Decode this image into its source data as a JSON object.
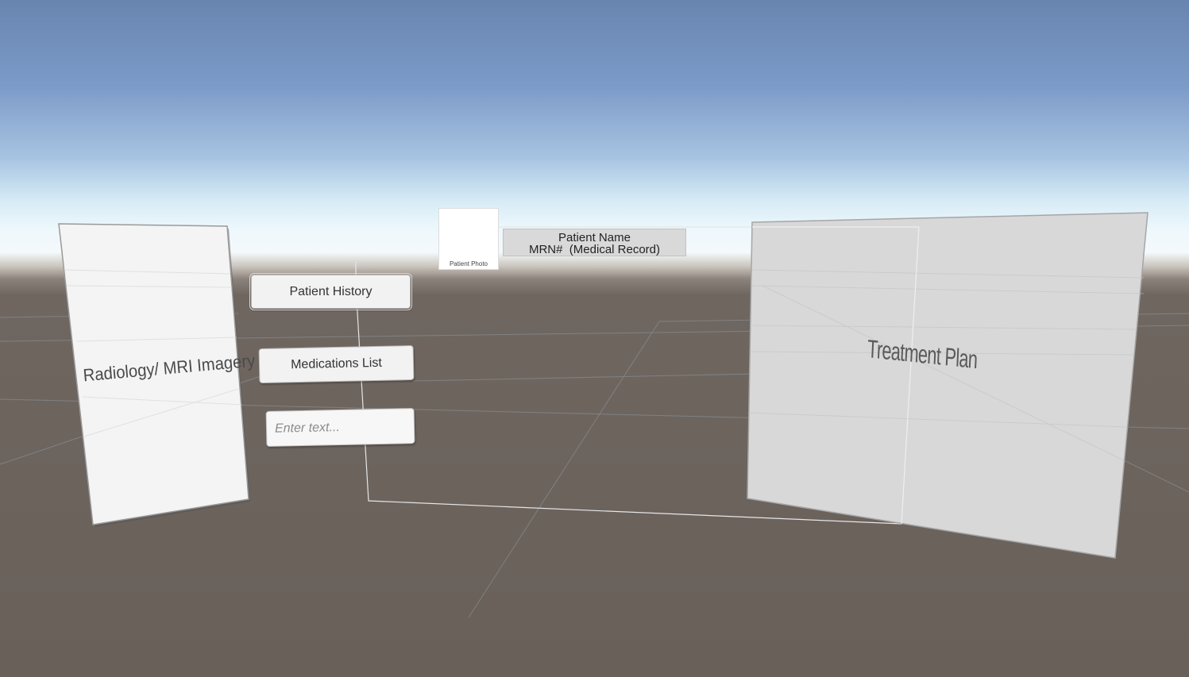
{
  "scene": {
    "radiology_panel_label": "Radiology/ MRI Imagery",
    "patient_history_label": "Patient History",
    "medications_list_label": "Medications List",
    "text_input": {
      "value": "",
      "placeholder": "Enter text..."
    },
    "patient_photo_label": "Patient Photo",
    "patient_name_label": "Patient Name",
    "mrn_label": "MRN#  (Medical Record)",
    "treatment_plan_label": "Treatment Plan"
  },
  "colors": {
    "sky_top": "#6885b0",
    "horizon": "#f4f9fb",
    "ground": "#69605a",
    "panel_white": "#f4f4f4",
    "panel_gray": "#d8d8d8"
  }
}
